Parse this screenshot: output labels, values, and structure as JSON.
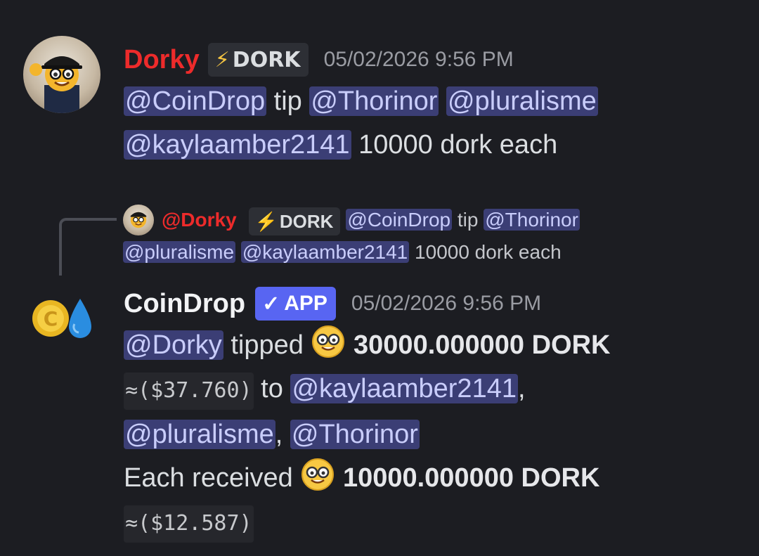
{
  "message1": {
    "username": "Dorky",
    "tag": {
      "icon": "lightning-icon",
      "glyph": "⚡",
      "label": "DORK"
    },
    "timestamp": "05/02/2026 9:56 PM",
    "mention_coindrop": "@CoinDrop",
    "word_tip": " tip ",
    "mention_thorinor": "@Thorinor",
    "mention_pluralisme": "@pluralisme",
    "mention_kayla": "@kaylaamber2141",
    "tail": " 10000 dork each"
  },
  "reply": {
    "username": "@Dorky",
    "tag": {
      "glyph": "⚡",
      "label": "DORK"
    },
    "mention_coindrop": "@CoinDrop",
    "word_tip": " tip ",
    "mention_thorinor": "@Thorinor",
    "mention_pluralisme": "@pluralisme",
    "mention_kayla": "@kaylaamber2141",
    "tail": " 10000 dork each"
  },
  "message2": {
    "username": "CoinDrop",
    "app_tag": {
      "glyph": "✓",
      "label": "APP"
    },
    "timestamp": "05/02/2026 9:56 PM",
    "mention_dorky": "@Dorky",
    "word_tipped": " tipped ",
    "total_amount": "30000.000000 DORK",
    "total_usd": "≈($37.760)",
    "word_to": " to ",
    "mention_kayla": "@kaylaamber2141",
    "comma1": ",",
    "mention_pluralisme": "@pluralisme",
    "comma2": ", ",
    "mention_thorinor": "@Thorinor",
    "each_received": " Each received ",
    "each_amount": "10000.000000 DORK",
    "each_usd": "≈($12.587)"
  },
  "colors": {
    "background": "#1c1d22",
    "mention_bg": "#3b3e75",
    "mention_text": "#c9cdfb",
    "username_red": "#ed2b2b",
    "app_tag": "#5865f2"
  }
}
